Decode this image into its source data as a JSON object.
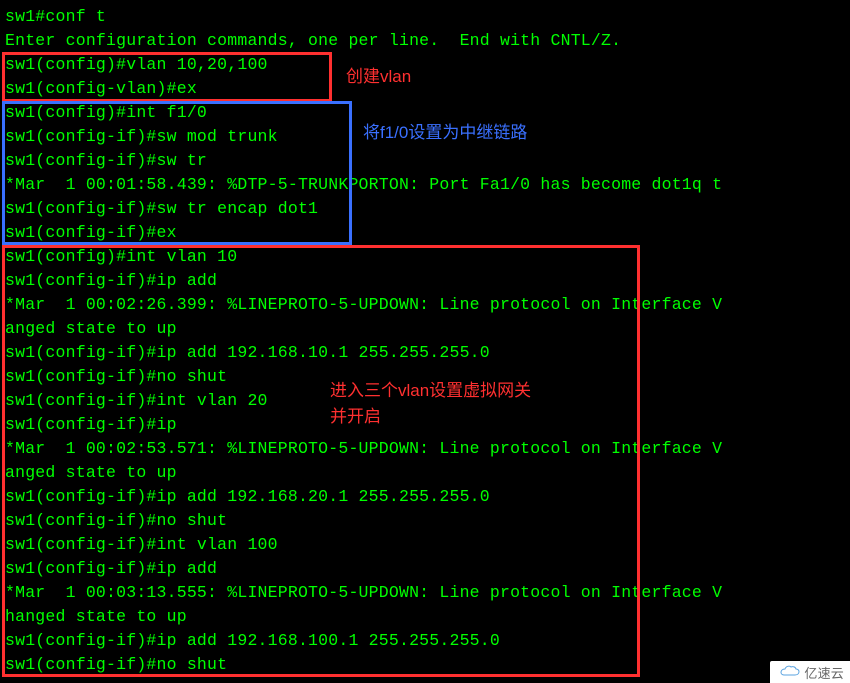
{
  "lines": [
    "sw1#conf t",
    "Enter configuration commands, one per line.  End with CNTL/Z.",
    "sw1(config)#vlan 10,20,100",
    "sw1(config-vlan)#ex",
    "sw1(config)#int f1/0",
    "sw1(config-if)#sw mod trunk",
    "sw1(config-if)#sw tr",
    "*Mar  1 00:01:58.439: %DTP-5-TRUNKPORTON: Port Fa1/0 has become dot1q t",
    "sw1(config-if)#sw tr encap dot1",
    "sw1(config-if)#ex",
    "sw1(config)#int vlan 10",
    "sw1(config-if)#ip add",
    "*Mar  1 00:02:26.399: %LINEPROTO-5-UPDOWN: Line protocol on Interface V",
    "anged state to up",
    "sw1(config-if)#ip add 192.168.10.1 255.255.255.0",
    "sw1(config-if)#no shut",
    "sw1(config-if)#int vlan 20",
    "sw1(config-if)#ip",
    "*Mar  1 00:02:53.571: %LINEPROTO-5-UPDOWN: Line protocol on Interface V",
    "anged state to up",
    "sw1(config-if)#ip add 192.168.20.1 255.255.255.0",
    "sw1(config-if)#no shut",
    "sw1(config-if)#int vlan 100",
    "sw1(config-if)#ip add",
    "*Mar  1 00:03:13.555: %LINEPROTO-5-UPDOWN: Line protocol on Interface V",
    "hanged state to up",
    "sw1(config-if)#ip add 192.168.100.1 255.255.255.0",
    "sw1(config-if)#no shut"
  ],
  "annotations": {
    "box1_label": "创建vlan",
    "box2_label": "将f1/0设置为中继链路",
    "box3_label_line1": "进入三个vlan设置虚拟网关",
    "box3_label_line2": "并开启"
  },
  "watermark": {
    "text": "亿速云"
  }
}
